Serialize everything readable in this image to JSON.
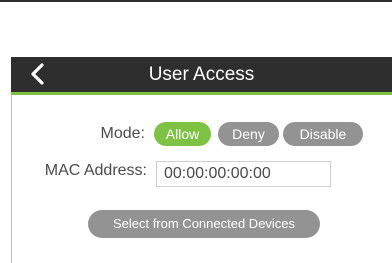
{
  "header": {
    "title": "User Access",
    "back_icon": "chevron-left-icon"
  },
  "form": {
    "mode_label": "Mode:",
    "mode_options": [
      "Allow",
      "Deny",
      "Disable"
    ],
    "mode_selected": "Allow",
    "mac_label": "MAC Address:",
    "mac_value": "00:00:00:00:00"
  },
  "actions": {
    "select_devices_label": "Select from Connected Devices"
  },
  "colors": {
    "accent": "#7dc242",
    "header_bg": "#2e2e2e",
    "inactive_pill": "#939393",
    "label_text": "#4a4a4a"
  }
}
